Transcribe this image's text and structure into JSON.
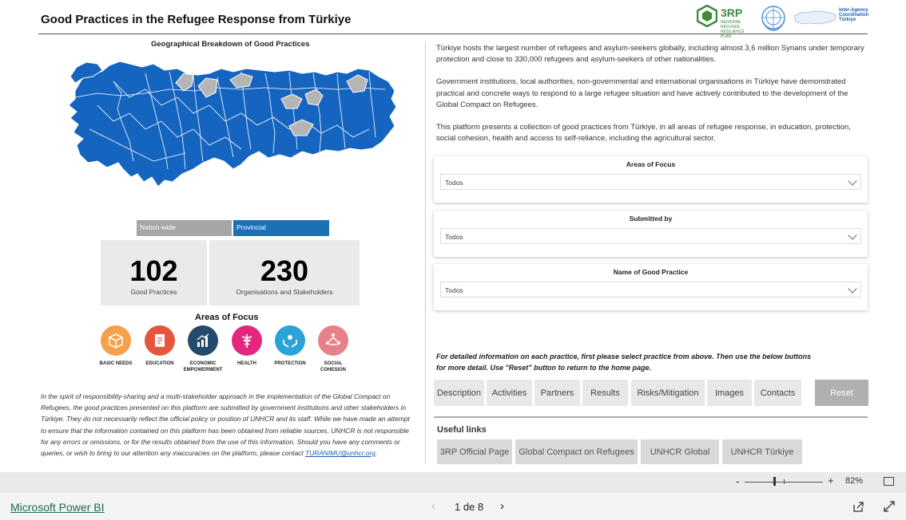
{
  "report": {
    "title": "Good Practices in the Refugee Response from Türkiye",
    "map_title": "Geographical Breakdown of Good Practices",
    "segments": {
      "nation": "Nation-wide",
      "provincial": "Provincial"
    },
    "kpis": [
      {
        "value": "102",
        "label": "Good Practices"
      },
      {
        "value": "230",
        "label": "Organisations and Stakeholders"
      }
    ],
    "areas_title": "Areas of Focus",
    "areas": [
      {
        "label1": "BASIC NEEDS",
        "label2": "",
        "color": "#f5a04a",
        "icon": "box-icon"
      },
      {
        "label1": "EDUCATION",
        "label2": "",
        "color": "#e8553e",
        "icon": "book-icon"
      },
      {
        "label1": "ECONOMIC",
        "label2": "EMPOWERMENT",
        "color": "#264a6e",
        "icon": "growth-icon"
      },
      {
        "label1": "HEALTH",
        "label2": "",
        "color": "#e5267f",
        "icon": "caduceus-icon"
      },
      {
        "label1": "PROTECTION",
        "label2": "",
        "color": "#2aa3d9",
        "icon": "hands-icon"
      },
      {
        "label1": "SOCIAL",
        "label2": "COHESION",
        "color": "#e8808c",
        "icon": "people-circle-icon"
      }
    ],
    "disclaimer": "In the spirit of responsibility-sharing and a multi-stakeholder approach in the implementation of the Global Compact on Refugees, the good practices presented on this platform are submitted by government institutions and other stakeholders in Türkiye. They do not necessarily reflect the official policy or position of UNHCR and its staff. While we have made an attempt to ensure that the information contained on this platform has been obtained from reliable sources, UNHCR is not responsible for any errors or omissions, or for the results obtained from the use of this information. Should you have any comments or queries, or wish to bring to our attention any inaccuracies on the platform, please contact ",
    "disclaimer_email": "TURANIMU@unhcr.org",
    "disclaimer_end": ".",
    "intro": [
      "Türkiye hosts the largest number of refugees and asylum-seekers globally, including almost 3,6 million Syrians under temporary protection and close to 330,000 refugees and asylum-seekers of other nationalities.",
      "Government institutions, local authorities, non-governmental and international organisations in Türkiye have demonstrated practical and concrete ways to respond to a large refugee situation and have actively contributed to the development of the Global Compact on Refugees.",
      "This platform presents a collection of good practices from Türkiye, in all areas of refugee response, in education, protection, social cohesion, health and access to self-reliance, including the agricultural sector."
    ],
    "slicers": [
      {
        "title": "Areas of Focus",
        "value": "Todos"
      },
      {
        "title": "Submitted by",
        "value": "Todos"
      },
      {
        "title": "Name of Good Practice",
        "value": "Todos"
      }
    ],
    "note": "For detailed information on each practice, first please select practice from above. Then use the below buttons for more detail. Use \"Reset\" button to return to the home page.",
    "buttons": [
      "Description",
      "Activities",
      "Partners",
      "Results",
      "Risks/Mitigation",
      "Images",
      "Contacts"
    ],
    "reset_label": "Reset",
    "useful_title": "Useful links",
    "links": [
      "3RP Official Page",
      "Global Compact on Refugees",
      "UNHCR Global",
      "UNHCR Türkiye"
    ],
    "logos": {
      "rp": "3RP",
      "rp_sub": "REGIONAL REFUGEE RESILIENCE PLAN",
      "iac": "Inter-Agency Coordination Türkiye"
    }
  },
  "zoom": {
    "minus": "-",
    "plus": "+",
    "percent": "82%"
  },
  "footer": {
    "brand": "Microsoft Power BI",
    "page": "1 de 8",
    "prev": "‹",
    "next": "›"
  },
  "colors": {
    "map_blue": "#1565c0",
    "map_grey": "#b5b5b5",
    "provincial": "#1a6fb5"
  }
}
